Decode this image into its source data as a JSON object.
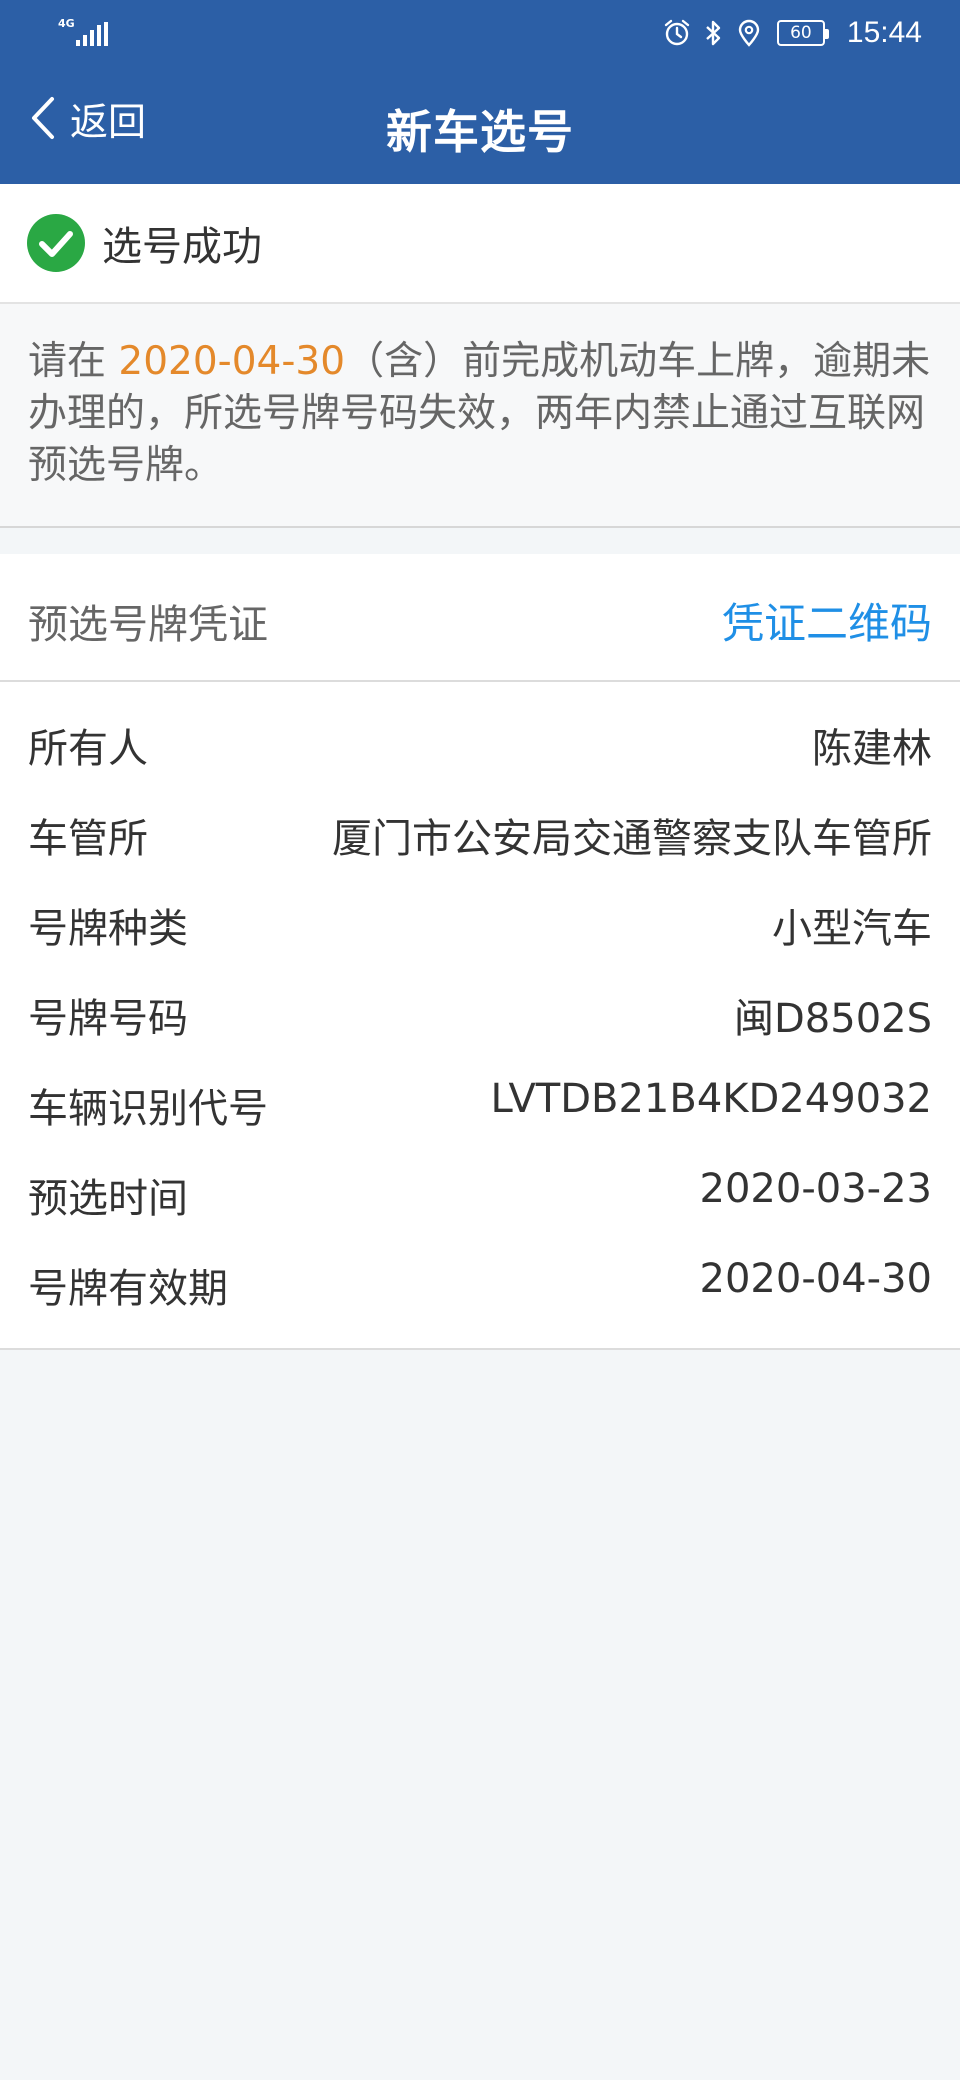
{
  "status_bar": {
    "network": "4G",
    "time": "15:44",
    "battery": "60",
    "icons": [
      "alarm-icon",
      "bluetooth-icon",
      "location-icon"
    ]
  },
  "nav": {
    "back_label": "返回",
    "title": "新车选号"
  },
  "success": {
    "text": "选号成功",
    "color": "#2aa844"
  },
  "notice": {
    "prefix": "请在 ",
    "date": "2020-04-30",
    "suffix": "（含）前完成机动车上牌，逾期未办理的，所选号牌号码失效，两年内禁止通过互联网预选号牌。"
  },
  "voucher": {
    "title": "预选号牌凭证",
    "qr_link": "凭证二维码"
  },
  "details": [
    {
      "key": "所有人",
      "value": "陈建林"
    },
    {
      "key": "车管所",
      "value": "厦门市公安局交通警察支队车管所"
    },
    {
      "key": "号牌种类",
      "value": "小型汽车"
    },
    {
      "key": "号牌号码",
      "value": "闽D8502S"
    },
    {
      "key": "车辆识别代号",
      "value": "LVTDB21B4KD249032"
    },
    {
      "key": "预选时间",
      "value": "2020-03-23"
    },
    {
      "key": "号牌有效期",
      "value": "2020-04-30"
    }
  ],
  "colors": {
    "header_bg": "#2c5fa6",
    "accent_link": "#1f8fe6",
    "date_highlight": "#e4892b"
  }
}
